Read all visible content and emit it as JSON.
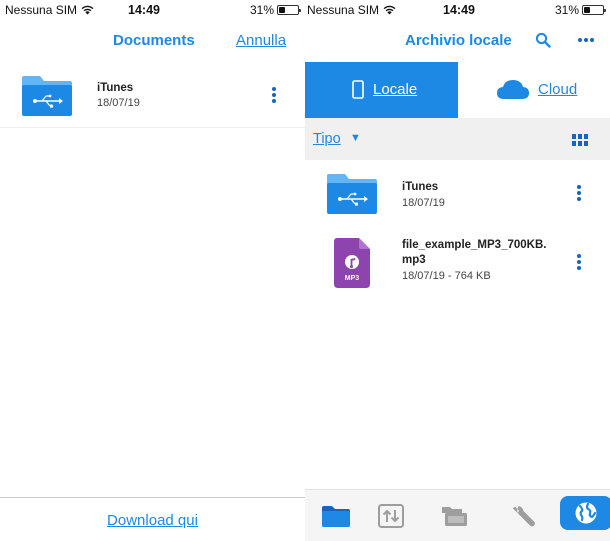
{
  "left_pane": {
    "status": {
      "carrier": "Nessuna SIM",
      "time": "14:49",
      "battery": "31%"
    },
    "nav": {
      "title": "Documents",
      "cancel_label": "Annulla"
    },
    "items": [
      {
        "name": "iTunes",
        "meta": "18/07/19",
        "icon": "usb-folder-icon"
      }
    ],
    "footer": {
      "download_label": "Download qui"
    }
  },
  "right_pane": {
    "status": {
      "carrier": "Nessuna SIM",
      "time": "14:49",
      "battery": "31%"
    },
    "nav": {
      "title": "Archivio locale",
      "search_icon": "search-icon",
      "more_icon": "more-icon"
    },
    "segments": [
      {
        "label": "Locale",
        "icon": "phone-icon",
        "selected": true
      },
      {
        "label": "Cloud",
        "icon": "cloud-icon",
        "selected": false
      }
    ],
    "filter": {
      "label": "Tipo",
      "view_icon": "grid-view-icon"
    },
    "items": [
      {
        "name": "iTunes",
        "meta": "18/07/19",
        "icon": "usb-folder-icon"
      },
      {
        "name_line1": "file_example_MP3_700KB.",
        "name_line2": "mp3",
        "meta": "18/07/19 - 764 KB",
        "icon": "mp3-file-icon",
        "icon_badge": "MP3"
      }
    ],
    "tab_bar": [
      {
        "icon": "folder-icon",
        "selected": false
      },
      {
        "icon": "transfer-icon",
        "selected": false
      },
      {
        "icon": "folders-icon",
        "selected": false
      },
      {
        "icon": "wrench-icon",
        "selected": false
      },
      {
        "icon": "globe-icon",
        "selected": true
      }
    ]
  },
  "colors": {
    "accent": "#1e88e5",
    "accent_dark": "#1565c0",
    "folder": "#2196f3",
    "mp3": "#8e44ad",
    "filter_bg": "#f0f0f0"
  }
}
